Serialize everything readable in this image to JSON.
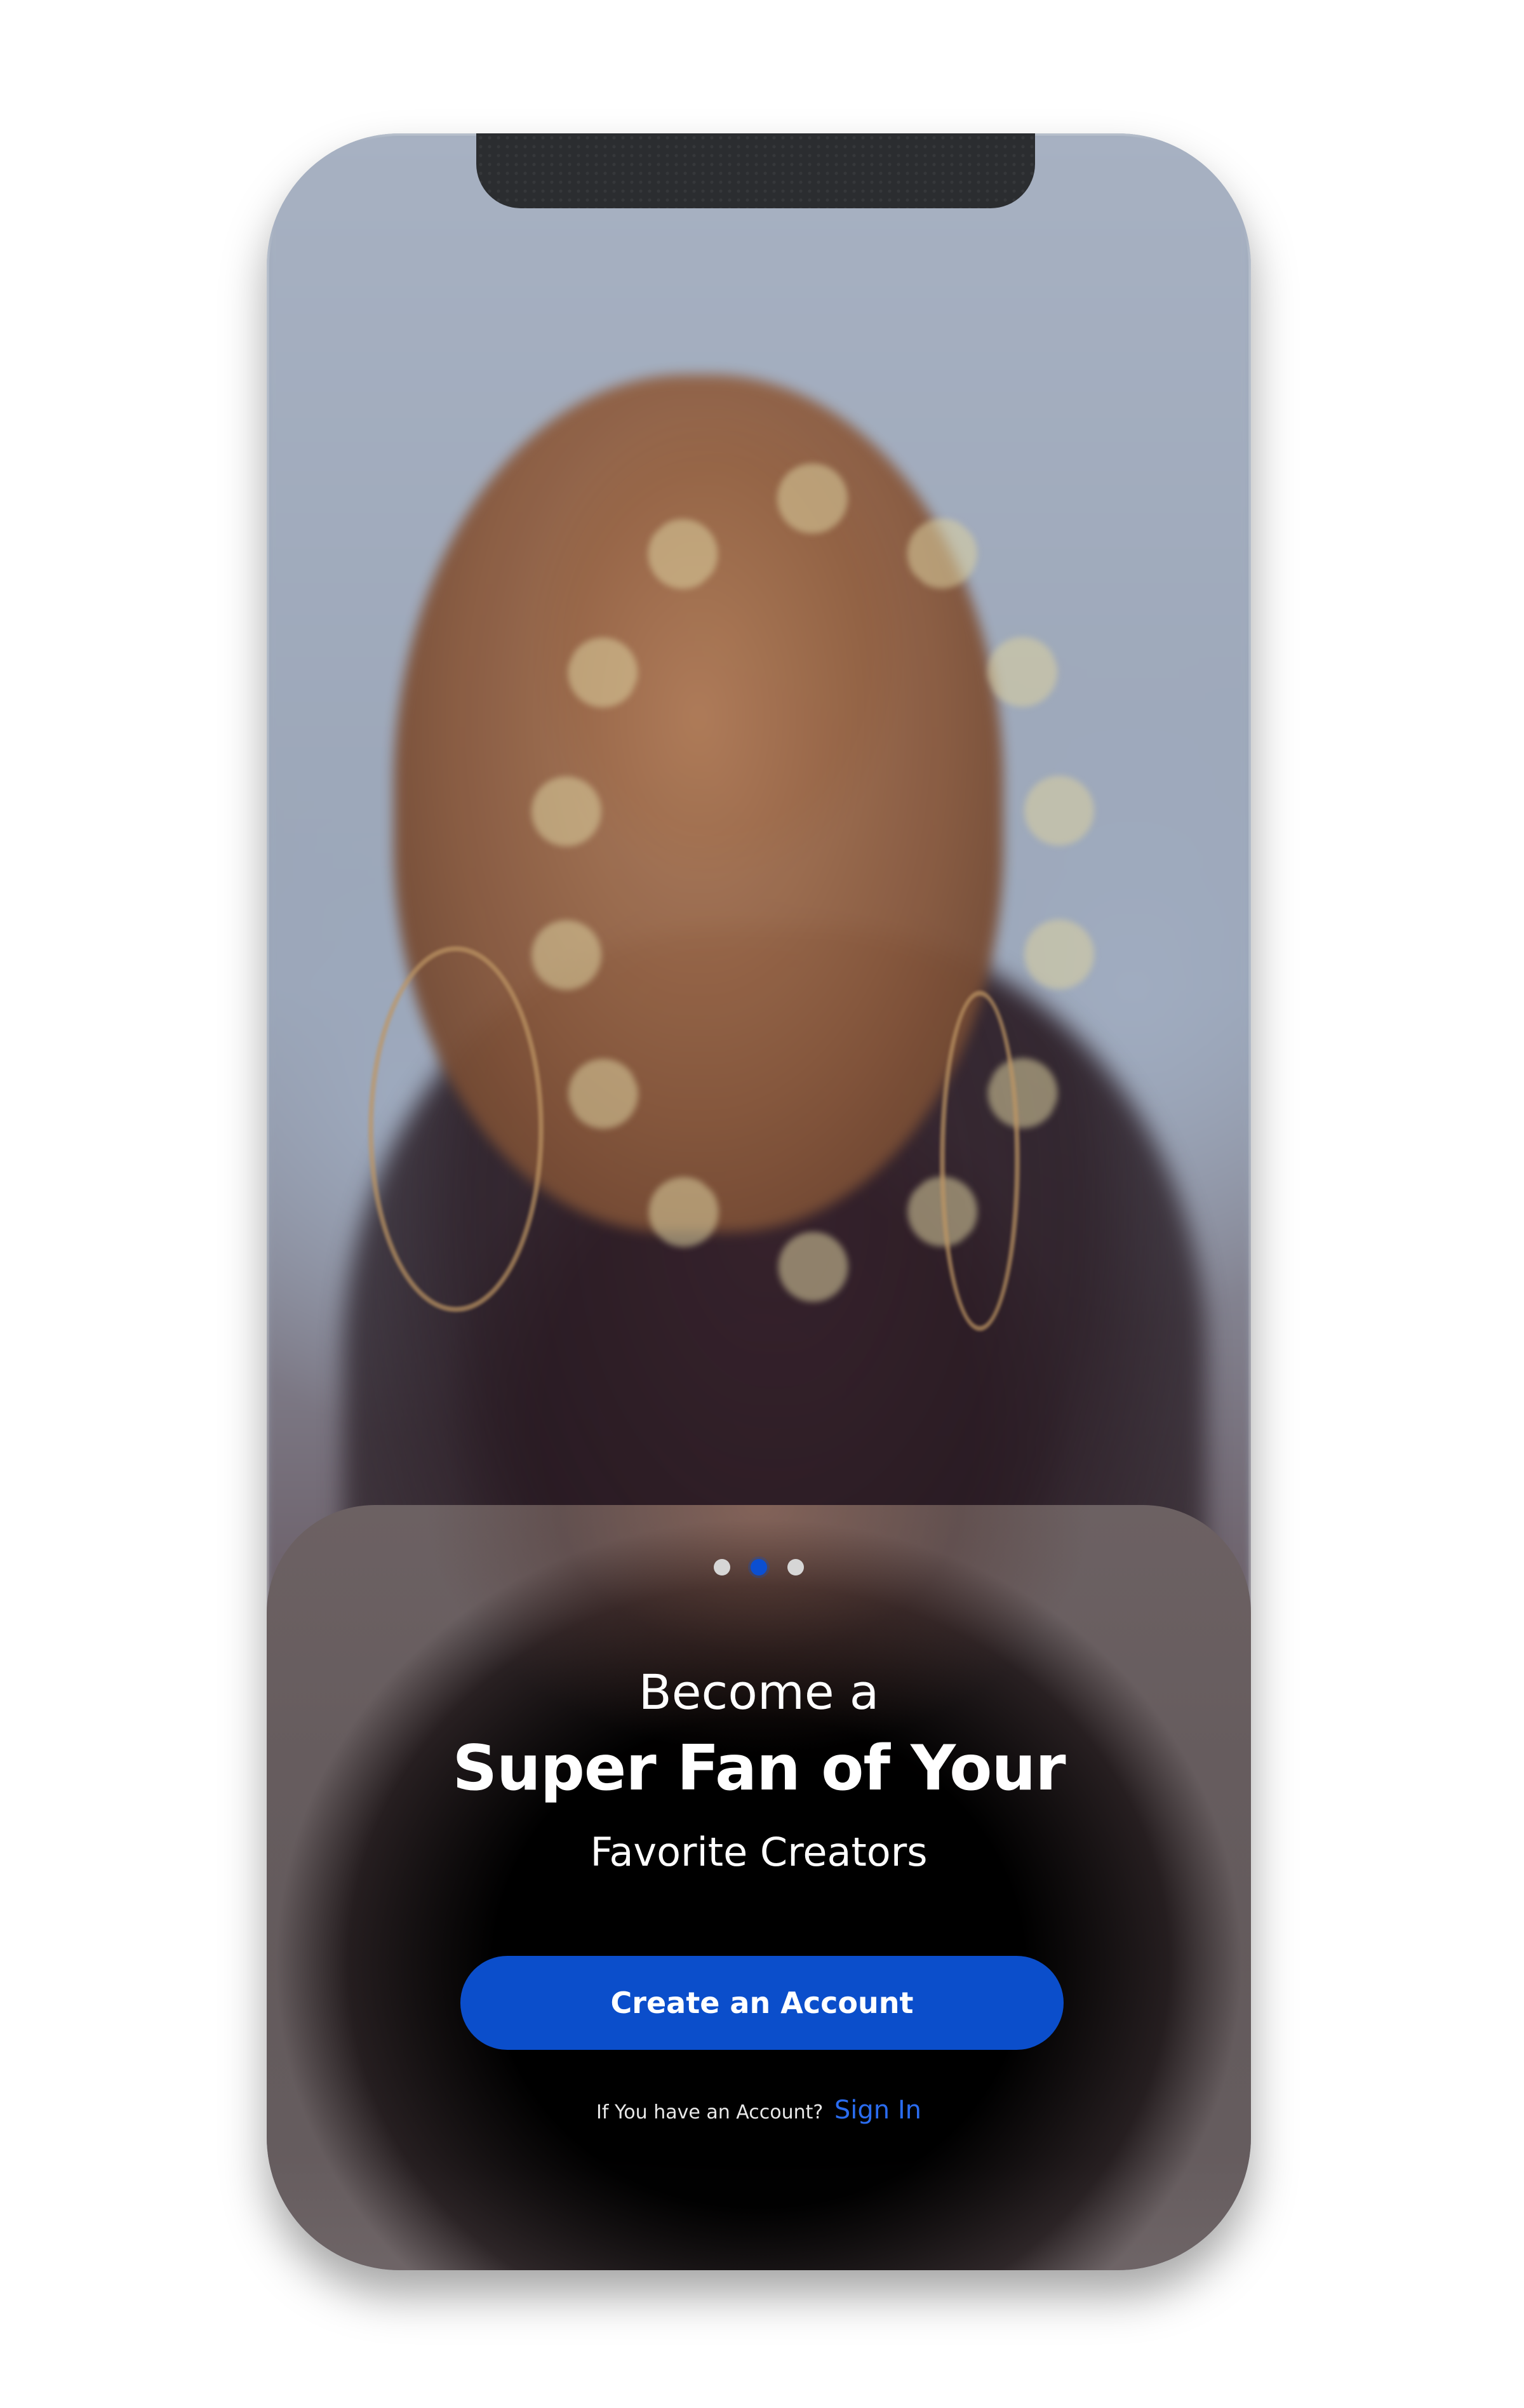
{
  "onboarding": {
    "carousel": {
      "total_pages": 3,
      "active_page": 2
    },
    "headline_line1": "Become a",
    "headline_line2": "Super Fan of Your",
    "headline_line3": "Favorite Creators",
    "primary_button_label": "Create an Account",
    "signin_prompt": "If You have an Account?",
    "signin_link_label": "Sign In"
  },
  "colors": {
    "accent": "#0B4ECB",
    "link": "#2A6CF0",
    "dot_inactive": "#D6D6D6"
  }
}
